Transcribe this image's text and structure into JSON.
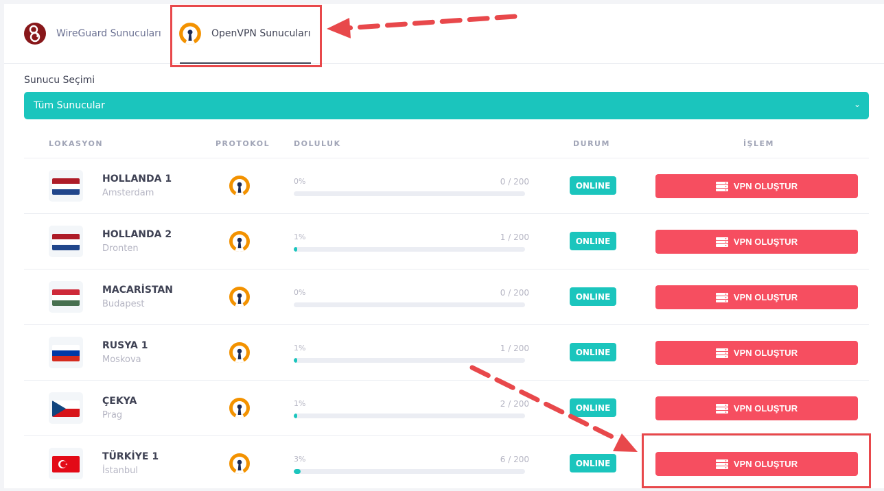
{
  "tabs": [
    {
      "label": "WireGuard Sunucuları",
      "active": false,
      "icon": "wireguard-icon"
    },
    {
      "label": "OpenVPN Sunucuları",
      "active": true,
      "icon": "openvpn-icon"
    }
  ],
  "server_select": {
    "label": "Sunucu Seçimi",
    "selected": "Tüm Sunucular"
  },
  "table": {
    "headers": {
      "location": "LOKASYON",
      "protocol": "PROTOKOL",
      "load": "DOLULUK",
      "status": "DURUM",
      "action": "İŞLEM"
    },
    "rows": [
      {
        "name": "HOLLANDA 1",
        "city": "Amsterdam",
        "flag": "netherlands",
        "percent": "0%",
        "capacity": "0 / 200",
        "load_fraction": 0,
        "status": "ONLINE",
        "action": "VPN OLUŞTUR"
      },
      {
        "name": "HOLLANDA 2",
        "city": "Dronten",
        "flag": "netherlands",
        "percent": "1%",
        "capacity": "1 / 200",
        "load_fraction": 0.01,
        "status": "ONLINE",
        "action": "VPN OLUŞTUR"
      },
      {
        "name": "MACARİSTAN",
        "city": "Budapest",
        "flag": "hungary",
        "percent": "0%",
        "capacity": "0 / 200",
        "load_fraction": 0,
        "status": "ONLINE",
        "action": "VPN OLUŞTUR"
      },
      {
        "name": "RUSYA 1",
        "city": "Moskova",
        "flag": "russia",
        "percent": "1%",
        "capacity": "1 / 200",
        "load_fraction": 0.01,
        "status": "ONLINE",
        "action": "VPN OLUŞTUR"
      },
      {
        "name": "ÇEKYA",
        "city": "Prag",
        "flag": "czechia",
        "percent": "1%",
        "capacity": "2 / 200",
        "load_fraction": 0.01,
        "status": "ONLINE",
        "action": "VPN OLUŞTUR"
      },
      {
        "name": "TÜRKİYE 1",
        "city": "İstanbul",
        "flag": "turkey",
        "percent": "3%",
        "capacity": "6 / 200",
        "load_fraction": 0.03,
        "status": "ONLINE",
        "action": "VPN OLUŞTUR"
      }
    ]
  },
  "colors": {
    "accent": "#1bc5bd",
    "danger": "#f64e60",
    "annotation": "#e8484b",
    "openvpn_orange": "#f39200",
    "openvpn_navy": "#1a2a56"
  }
}
